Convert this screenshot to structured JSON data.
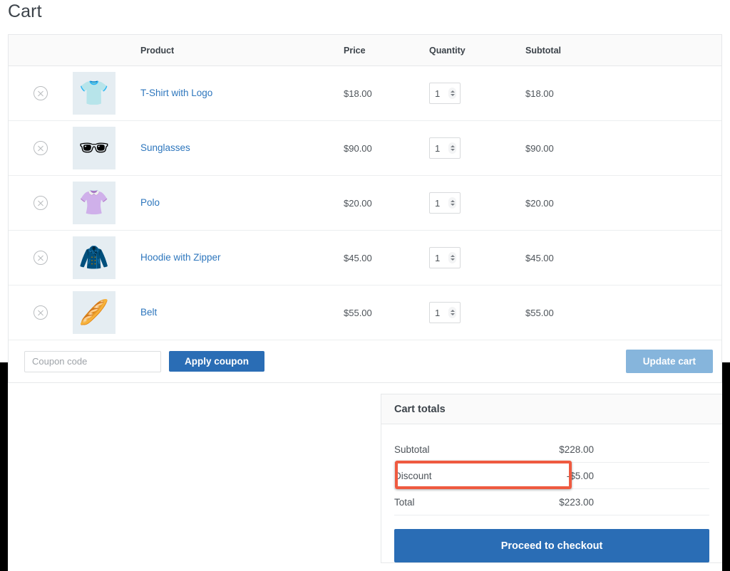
{
  "page": {
    "title": "Cart"
  },
  "table": {
    "columns": {
      "remove": "",
      "thumbnail": "",
      "product": "Product",
      "price": "Price",
      "quantity": "Quantity",
      "subtotal": "Subtotal"
    },
    "rows": [
      {
        "remove_icon": "remove-circle-icon",
        "thumb": "👕",
        "name": "T-Shirt with Logo",
        "price": "$18.00",
        "qty": "1",
        "subtotal": "$18.00"
      },
      {
        "remove_icon": "remove-circle-icon",
        "thumb": "🕶",
        "name": "Sunglasses",
        "price": "$90.00",
        "qty": "1",
        "subtotal": "$90.00"
      },
      {
        "remove_icon": "remove-circle-icon",
        "thumb": "👚",
        "name": "Polo",
        "price": "$20.00",
        "qty": "1",
        "subtotal": "$20.00"
      },
      {
        "remove_icon": "remove-circle-icon",
        "thumb": "🧥",
        "name": "Hoodie with Zipper",
        "price": "$45.00",
        "qty": "1",
        "subtotal": "$45.00"
      },
      {
        "remove_icon": "remove-circle-icon",
        "thumb": "🥖",
        "name": "Belt",
        "price": "$55.00",
        "qty": "1",
        "subtotal": "$55.00"
      }
    ]
  },
  "coupon": {
    "placeholder": "Coupon code",
    "value": "",
    "apply_label": "Apply coupon",
    "update_label": "Update cart"
  },
  "totals": {
    "title": "Cart totals",
    "rows": [
      {
        "label": "Subtotal",
        "value": "$228.00"
      },
      {
        "label": "Discount",
        "value": "-$5.00"
      },
      {
        "label": "Total",
        "value": "$223.00"
      }
    ],
    "checkout_label": "Proceed to checkout"
  },
  "colors": {
    "accent_blue": "#2a6db5",
    "link_blue": "#2d76bd",
    "disabled_blue": "#86b5dc",
    "highlight_red": "#ef5a40",
    "thumb_bg": "#e5edf2",
    "header_bg": "#fafafa"
  }
}
